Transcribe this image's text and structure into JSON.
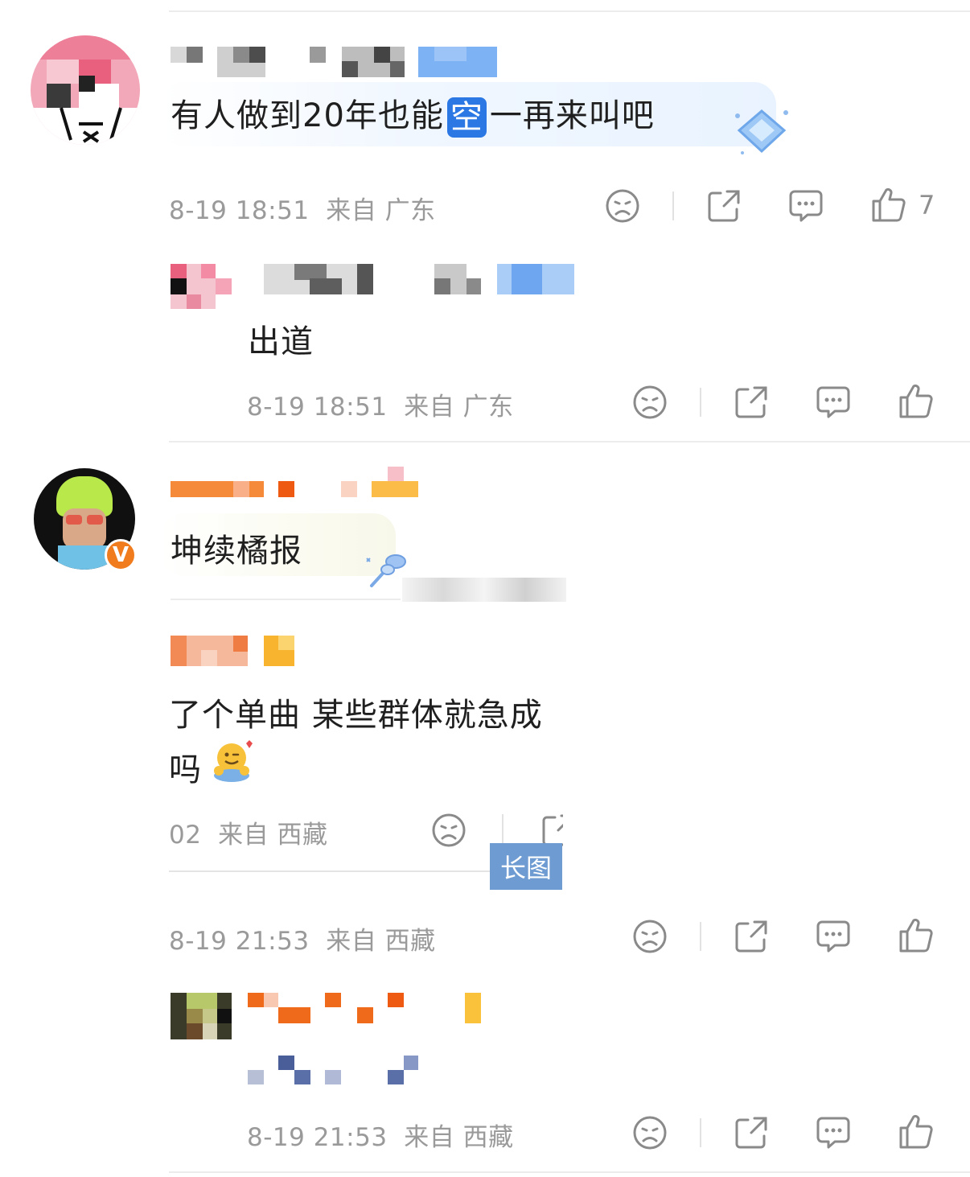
{
  "comments": [
    {
      "text_before": "有人做到20年也能",
      "text_highlight": "空",
      "text_after": "一再来叫吧",
      "time": "8-19 18:51",
      "location": "来自 广东",
      "like_count": "7",
      "reply": {
        "text": "出道",
        "time": "8-19 18:51",
        "location": "来自 广东"
      }
    },
    {
      "text": "坤续橘报",
      "screenshot": {
        "line1": "了个单曲 某些群体就急成",
        "line2": "吗",
        "meta_time": "02",
        "meta_location": "来自 西藏",
        "long_image_tag": "长图"
      },
      "time": "8-19 21:53",
      "location": "来自 西藏",
      "reply": {
        "time": "8-19 21:53",
        "location": "来自 西藏"
      }
    }
  ],
  "colors": {
    "meta": "#9a9a9a",
    "highlight": "#2b78e4",
    "tag": "#6e9bd1",
    "verified": "#f07c1e"
  },
  "icons": [
    "sad-face-icon",
    "share-icon",
    "comment-icon",
    "thumbs-up-icon"
  ]
}
